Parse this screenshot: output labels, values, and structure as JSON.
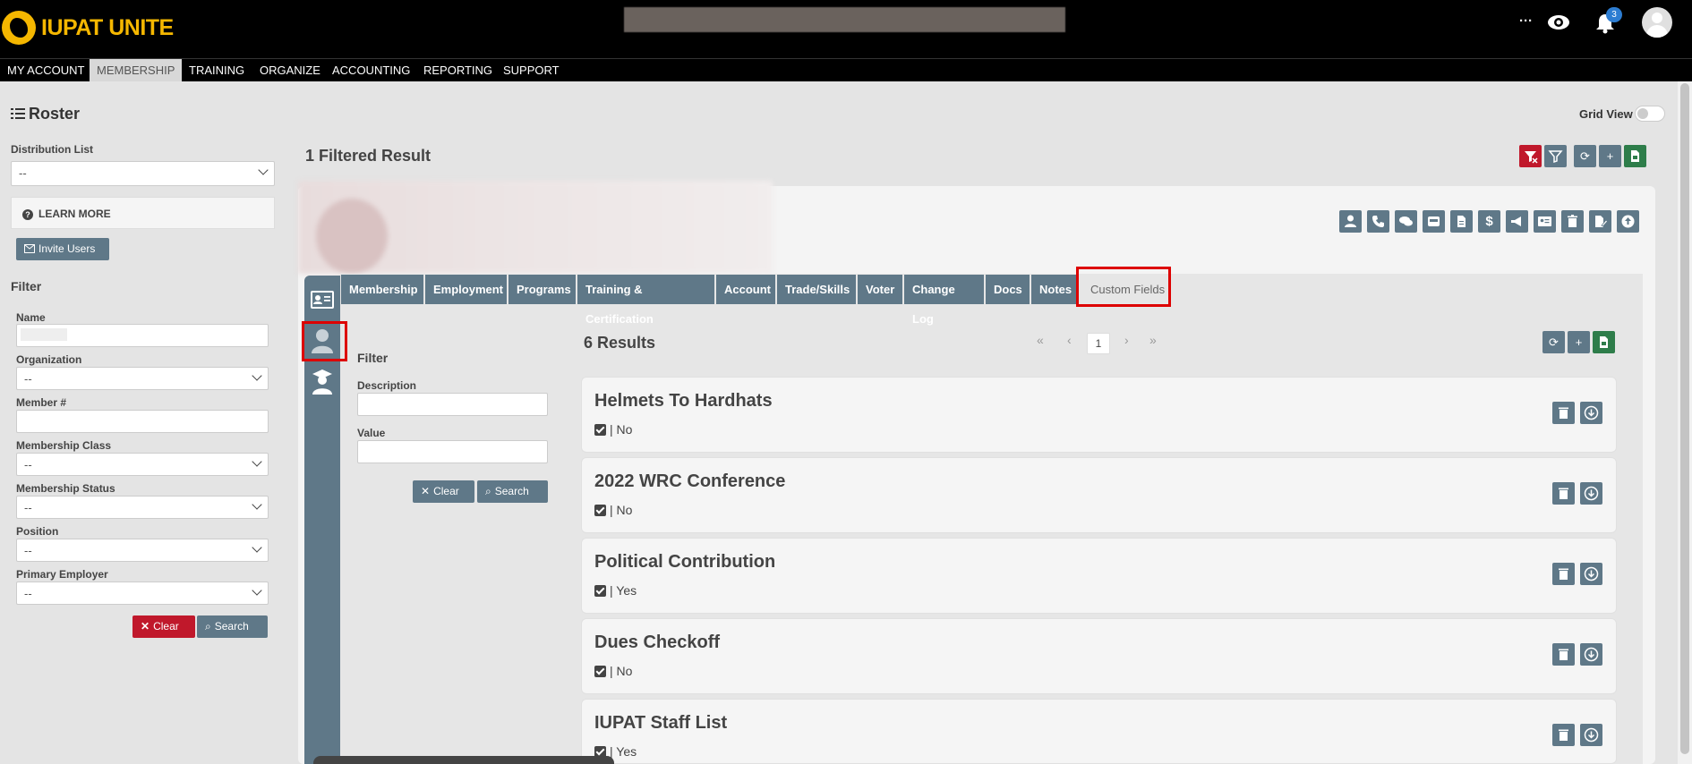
{
  "app": {
    "logo_text": "IUPAT UNITE",
    "notification_count": "3",
    "more_label": "···"
  },
  "menu": [
    {
      "label": "MY ACCOUNT"
    },
    {
      "label": "MEMBERSHIP"
    },
    {
      "label": "TRAINING"
    },
    {
      "label": "ORGANIZE"
    },
    {
      "label": "ACCOUNTING"
    },
    {
      "label": "REPORTING"
    },
    {
      "label": "SUPPORT"
    }
  ],
  "page": {
    "title": "Roster",
    "grid_view_label": "Grid View"
  },
  "left": {
    "distribution_label": "Distribution List",
    "distribution_value": "--",
    "learn_more": "LEARN MORE",
    "invite_users": "Invite Users",
    "filter_heading": "Filter",
    "name_label": "Name",
    "organization_label": "Organization",
    "organization_value": "--",
    "member_label": "Member #",
    "class_label": "Membership Class",
    "class_value": "--",
    "status_label": "Membership Status",
    "status_value": "--",
    "position_label": "Position",
    "position_value": "--",
    "employer_label": "Primary Employer",
    "employer_value": "--",
    "clear": "Clear",
    "search": "Search"
  },
  "main": {
    "filtered_results": "1 Filtered Result",
    "tabs": [
      {
        "label": "Membership"
      },
      {
        "label": "Employment"
      },
      {
        "label": "Programs"
      },
      {
        "label": "Training & Certification"
      },
      {
        "label": "Account"
      },
      {
        "label": "Trade/Skills"
      },
      {
        "label": "Voter"
      },
      {
        "label": "Change Log"
      },
      {
        "label": "Docs"
      },
      {
        "label": "Notes"
      },
      {
        "label": "Custom Fields"
      }
    ],
    "inner_filter": {
      "heading": "Filter",
      "description_label": "Description",
      "value_label": "Value",
      "clear": "Clear",
      "search": "Search"
    },
    "results_count": "6 Results",
    "current_page": "1",
    "custom_fields": [
      {
        "title": "Helmets To Hardhats",
        "value": "| No"
      },
      {
        "title": "2022 WRC Conference",
        "value": "| No"
      },
      {
        "title": "Political Contribution",
        "value": "| Yes"
      },
      {
        "title": "Dues Checkoff",
        "value": "| No"
      },
      {
        "title": "IUPAT Staff List",
        "value": "| Yes"
      }
    ]
  },
  "colors": {
    "slate": "#5f7888",
    "red": "#c0182b",
    "green": "#2e7d4a",
    "brand_yellow": "#f5b700",
    "highlight": "#dd0000"
  }
}
